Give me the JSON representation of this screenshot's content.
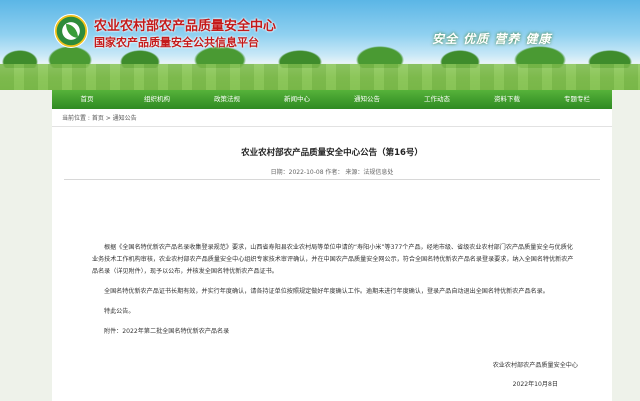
{
  "header": {
    "title": "农业农村部农产品质量安全中心",
    "subtitle": "国家农产品质量安全公共信息平台",
    "slogan": "安全 优质 营养 健康"
  },
  "nav": {
    "items": [
      {
        "label": "首页"
      },
      {
        "label": "组织机构"
      },
      {
        "label": "政策法规"
      },
      {
        "label": "新闻中心"
      },
      {
        "label": "通知公告"
      },
      {
        "label": "工作动态"
      },
      {
        "label": "资料下载"
      },
      {
        "label": "专题专栏"
      }
    ]
  },
  "breadcrumb": "当前位置 : 首页 > 通知公告",
  "article": {
    "title": "农业农村部农产品质量安全中心公告（第16号）",
    "meta": "日期：2022-10-08  作者：   来源：法规信息处",
    "paragraphs": [
      "根据《全国名特优新农产品名录收集登录规范》要求，山西省寿阳县农业农村局等单位申请的“寿阳小米”等377个产品，经地市级、省级农业农村部门农产品质量安全与优质化业务技术工作机构审核，农业农村部农产品质量安全中心组织专家技术审评确认，并在中国农产品质量安全网公示，符合全国名特优新农产品名录登录要求，纳入全国名特优新农产品名录（详见附件），现予以公布，并核发全国名特优新农产品证书。",
      "全国名特优新农产品证书长期有效，并实行年度确认，请各持证单位按照规定做好年度确认工作。逾期未进行年度确认，登录产品自动退出全国名特优新农产品名录。",
      "特此公告。",
      "附件：2022年第二批全国名特优新农产品名录"
    ],
    "signature": "农业农村部农产品质量安全中心",
    "date": "2022年10月8日"
  }
}
